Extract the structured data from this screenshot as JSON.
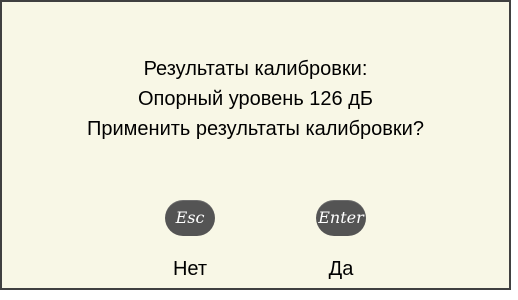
{
  "dialog": {
    "lines": [
      "Результаты калибровки:",
      "Опорный уровень 126 дБ",
      "Применить результаты калибровки?"
    ]
  },
  "buttons": {
    "esc": {
      "key_label": "Esc",
      "action_label": "Нет"
    },
    "enter": {
      "key_label": "Enter",
      "action_label": "Да"
    }
  },
  "colors": {
    "background": "#f8f7e6",
    "key": "#545454",
    "border": "#404040"
  }
}
